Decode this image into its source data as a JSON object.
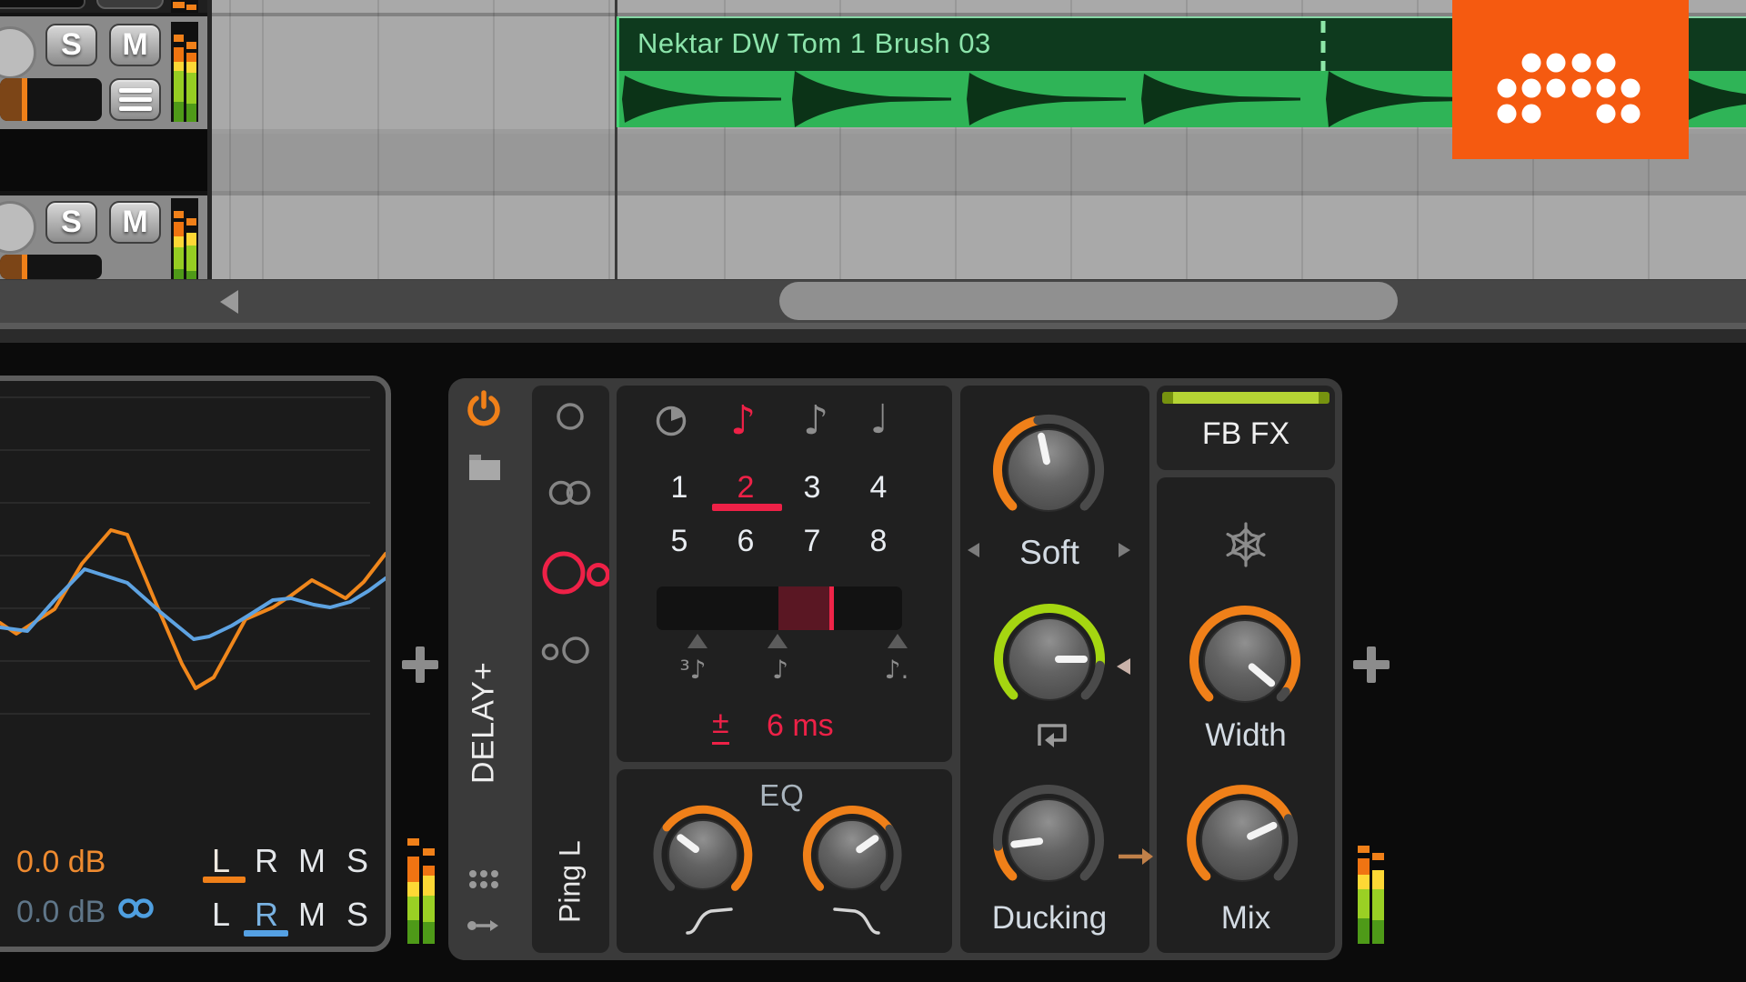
{
  "arranger": {
    "clip": {
      "title": "Nektar DW Tom 1 Brush 03"
    },
    "tracks": [
      {
        "solo_label": "S",
        "mute_label": "M"
      },
      {
        "solo_label": "S",
        "mute_label": "M"
      }
    ]
  },
  "device": {
    "name": "DELAY+",
    "preset_page": "Ping L",
    "accent_orange": "#f08019",
    "accent_red": "#ee2147",
    "accent_green": "#a5d611",
    "fx_bar_green": "#b5d434",
    "time": {
      "divisions": [
        "1",
        "2",
        "3",
        "4",
        "5",
        "6",
        "7",
        "8"
      ],
      "selected_division": "2",
      "note_mode_icons": [
        "♪",
        "♪",
        "♩"
      ],
      "swing_markers": [
        "³♪",
        "♪",
        "♪."
      ],
      "offset_sign": "±",
      "offset_value": "6 ms"
    },
    "eq": {
      "label": "EQ"
    },
    "feedback": {
      "mode_value": "Soft"
    },
    "fb_fx": {
      "label": "FB FX"
    },
    "width_label": "Width",
    "mix_label": "Mix",
    "ducking_label": "Ducking"
  },
  "analyzer": {
    "gain_top": "0.0 dB",
    "gain_bottom": "0.0 dB",
    "channels_top": [
      "L",
      "R",
      "M",
      "S"
    ],
    "channels_bottom": [
      "L",
      "R",
      "M",
      "S"
    ],
    "selected_top": "L",
    "selected_bottom": "R"
  }
}
